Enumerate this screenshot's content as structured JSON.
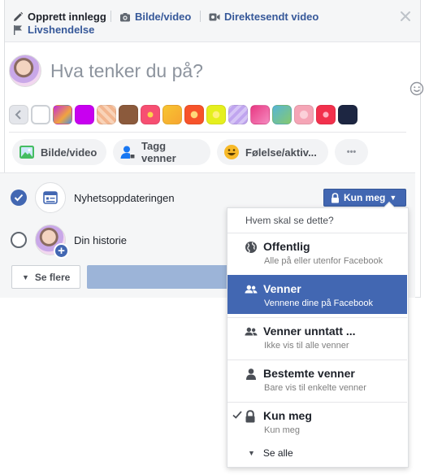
{
  "tabs": {
    "create_post": "Opprett innlegg",
    "photo_video": "Bilde/video",
    "live_video": "Direktesendt video",
    "life_event": "Livshendelse"
  },
  "composer": {
    "placeholder": "Hva tenker du på?"
  },
  "swatch_colors": [
    "#f5f6f7",
    "#ffffff",
    "#c42dd6",
    "#c800f0",
    "#f3b690",
    "#8b5a3c",
    "#f74f72",
    "#f7c531",
    "#f7532a",
    "#e5ef1e",
    "#c0a5ef",
    "#e83882",
    "#56b5d6",
    "#f5a5b6",
    "#f2304c",
    "#1d2642"
  ],
  "actions": {
    "photo_video": "Bilde/video",
    "tag_friends": "Tagg venner",
    "feeling": "Følelse/aktiv...",
    "more": "•••"
  },
  "share": {
    "news_feed": "Nyhetsoppdateringen",
    "your_story": "Din historie",
    "privacy_button": "Kun meg",
    "see_more": "Se flere"
  },
  "dropdown": {
    "header": "Hvem skal se dette?",
    "items": [
      {
        "title": "Offentlig",
        "subtitle": "Alle på eller utenfor Facebook"
      },
      {
        "title": "Venner",
        "subtitle": "Vennene dine på Facebook"
      },
      {
        "title": "Venner unntatt ...",
        "subtitle": "Ikke vis til alle venner"
      },
      {
        "title": "Bestemte venner",
        "subtitle": "Bare vis til enkelte venner"
      },
      {
        "title": "Kun meg",
        "subtitle": "Kun meg"
      }
    ],
    "see_all": "Se alle"
  },
  "colors": {
    "accent": "#4267b2",
    "link": "#365899"
  }
}
